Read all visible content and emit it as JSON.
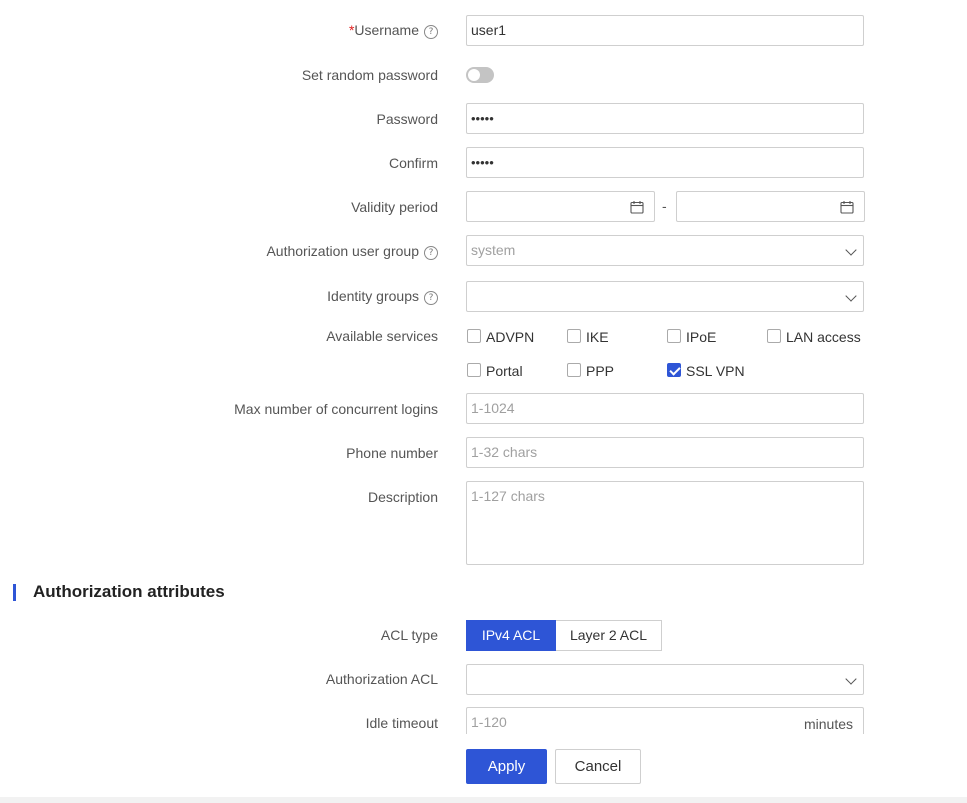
{
  "form": {
    "username": {
      "required_mark": "*",
      "label": "Username",
      "help": "?",
      "value": "user1"
    },
    "random_password": {
      "label": "Set random password",
      "enabled": false
    },
    "password": {
      "label": "Password",
      "value": "•••••"
    },
    "confirm": {
      "label": "Confirm",
      "value": "•••••"
    },
    "validity": {
      "label": "Validity period",
      "separator": "-",
      "start": "",
      "end": ""
    },
    "auth_group": {
      "label": "Authorization user group",
      "help": "?",
      "placeholder": "system"
    },
    "identity_groups": {
      "label": "Identity groups",
      "help": "?",
      "value": ""
    },
    "services": {
      "label": "Available services",
      "items": [
        {
          "name": "ADVPN",
          "checked": false
        },
        {
          "name": "IKE",
          "checked": false
        },
        {
          "name": "IPoE",
          "checked": false
        },
        {
          "name": "LAN access",
          "checked": false
        },
        {
          "name": "Portal",
          "checked": false
        },
        {
          "name": "PPP",
          "checked": false
        },
        {
          "name": "SSL VPN",
          "checked": true
        }
      ]
    },
    "max_logins": {
      "label": "Max number of concurrent logins",
      "placeholder": "1-1024"
    },
    "phone": {
      "label": "Phone number",
      "placeholder": "1-32 chars"
    },
    "description": {
      "label": "Description",
      "placeholder": "1-127 chars"
    }
  },
  "auth_section": {
    "title": "Authorization attributes",
    "acl_type": {
      "label": "ACL type",
      "options": [
        "IPv4 ACL",
        "Layer 2 ACL"
      ],
      "selected": "IPv4 ACL"
    },
    "auth_acl": {
      "label": "Authorization ACL",
      "value": ""
    },
    "idle_timeout": {
      "label": "Idle timeout",
      "placeholder": "1-120",
      "unit": "minutes"
    }
  },
  "actions": {
    "apply": "Apply",
    "cancel": "Cancel"
  },
  "colors": {
    "accent": "#2e55d6",
    "required": "#e02020"
  }
}
